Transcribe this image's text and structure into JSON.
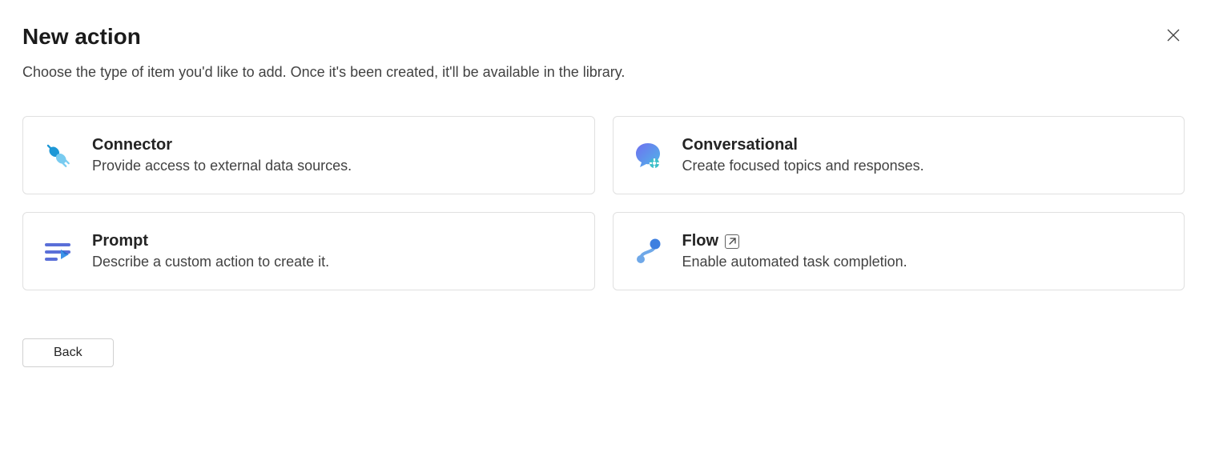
{
  "header": {
    "title": "New action",
    "subtitle": "Choose the type of item you'd like to add. Once it's been created, it'll be available in the library."
  },
  "cards": {
    "connector": {
      "title": "Connector",
      "desc": "Provide access to external data sources."
    },
    "conversational": {
      "title": "Conversational",
      "desc": "Create focused topics and responses."
    },
    "prompt": {
      "title": "Prompt",
      "desc": "Describe a custom action to create it."
    },
    "flow": {
      "title": "Flow",
      "desc": "Enable automated task completion."
    }
  },
  "buttons": {
    "back": "Back"
  }
}
